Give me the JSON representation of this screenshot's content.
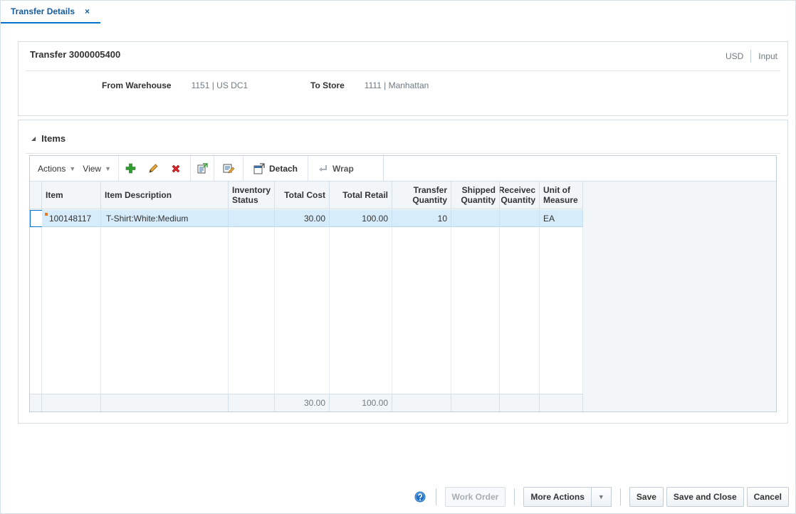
{
  "tab": {
    "label": "Transfer Details",
    "close_glyph": "×"
  },
  "header": {
    "title": "Transfer 3000005400",
    "currency": "USD",
    "mode": "Input",
    "from_label": "From Warehouse",
    "from_value": "1151  |  US DC1",
    "to_label": "To Store",
    "to_value": "1111  |  Manhattan"
  },
  "items": {
    "section_title": "Items",
    "toolbar": {
      "actions_label": "Actions",
      "view_label": "View",
      "detach_label": "Detach",
      "wrap_label": "Wrap",
      "icons": [
        "add-icon",
        "edit-icon",
        "delete-icon",
        "export-icon",
        "edit-range-icon",
        "detach-icon",
        "wrap-icon"
      ]
    },
    "columns": {
      "item": "Item",
      "description": "Item Description",
      "inv_status_1": "Inventory",
      "inv_status_2": "Status",
      "total_cost": "Total Cost",
      "total_retail": "Total Retail",
      "transfer_qty_1": "Transfer",
      "transfer_qty_2": "Quantity",
      "shipped_qty_1": "Shipped",
      "shipped_qty_2": "Quantity",
      "received_qty_1": "Receivec",
      "received_qty_2": "Quantity",
      "uom_1": "Unit of",
      "uom_2": "Measure"
    },
    "rows": [
      {
        "item": "100148117",
        "description": "T-Shirt:White:Medium",
        "inventory_status": "",
        "total_cost": "30.00",
        "total_retail": "100.00",
        "transfer_quantity": "10",
        "shipped_quantity": "",
        "received_quantity": "",
        "unit_of_measure": "EA"
      }
    ],
    "totals": {
      "total_cost": "30.00",
      "total_retail": "100.00"
    }
  },
  "footer": {
    "work_order": "Work Order",
    "more_actions": "More Actions",
    "save": "Save",
    "save_and_close": "Save and Close",
    "cancel": "Cancel"
  },
  "colors": {
    "accent": "#0572ce",
    "selected_row": "#d6ecfa",
    "add_icon": "#2f9e2f",
    "delete_icon": "#d8262b"
  }
}
